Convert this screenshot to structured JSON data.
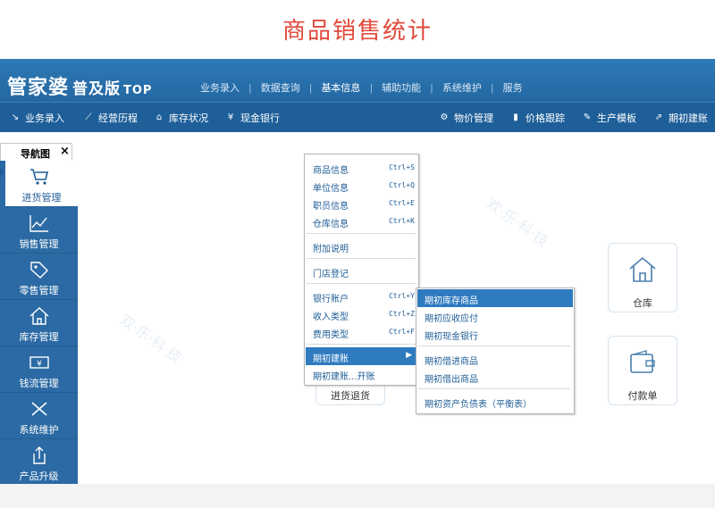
{
  "page_title": "商品销售统计",
  "app": {
    "logo": {
      "main": "管家婆",
      "edition": "普及版",
      "tag": "TOP"
    },
    "top_menu": [
      {
        "label": "业务录入"
      },
      {
        "label": "数据查询"
      },
      {
        "label": "基本信息",
        "active": true
      },
      {
        "label": "辅助功能"
      },
      {
        "label": "系统维护"
      },
      {
        "label": "服务"
      }
    ],
    "toolbar": [
      {
        "label": "业务录入",
        "icon": "arrow-icon"
      },
      {
        "label": "经营历程",
        "icon": "chart-icon"
      },
      {
        "label": "库存状况",
        "icon": "home-icon"
      },
      {
        "label": "现金银行",
        "icon": "yen-icon"
      },
      {
        "label": "物价管理",
        "icon": "gear-icon"
      },
      {
        "label": "价格跟踪",
        "icon": "bar-icon"
      },
      {
        "label": "生产模板",
        "icon": "wrench-icon"
      },
      {
        "label": "期初建账",
        "icon": "share-icon"
      }
    ],
    "nav_tab": {
      "label": "导航图",
      "close": "×"
    },
    "sidebar": [
      {
        "label": "进货管理",
        "icon": "cart-icon",
        "active": true
      },
      {
        "label": "销售管理",
        "icon": "line-chart-icon"
      },
      {
        "label": "零售管理",
        "icon": "tag-icon"
      },
      {
        "label": "库存管理",
        "icon": "house-icon"
      },
      {
        "label": "钱流管理",
        "icon": "money-icon"
      },
      {
        "label": "系统维护",
        "icon": "tools-icon"
      },
      {
        "label": "产品升级",
        "icon": "upload-icon"
      }
    ],
    "cards": [
      {
        "label": "仓库",
        "icon": "house-icon"
      },
      {
        "label": "进货退货",
        "icon": "return-doc-icon"
      },
      {
        "label": "付款单",
        "icon": "wallet-icon"
      }
    ],
    "dropdown": [
      {
        "label": "商品信息",
        "shortcut": "Ctrl+S"
      },
      {
        "label": "单位信息",
        "shortcut": "Ctrl+Q"
      },
      {
        "label": "职员信息",
        "shortcut": "Ctrl+E"
      },
      {
        "label": "仓库信息",
        "shortcut": "Ctrl+K"
      },
      {
        "label": "附加说明",
        "shortcut": ""
      },
      {
        "label": "门店登记",
        "shortcut": ""
      },
      {
        "label": "银行账户",
        "shortcut": "Ctrl+Y"
      },
      {
        "label": "收入类型",
        "shortcut": "Ctrl+Z"
      },
      {
        "label": "费用类型",
        "shortcut": "Ctrl+F"
      },
      {
        "label": "期初建账",
        "shortcut": "",
        "selected": true,
        "arrow": "▶"
      },
      {
        "label": "期初建账...开账",
        "shortcut": ""
      }
    ],
    "submenu": [
      {
        "label": "期初库存商品",
        "selected": true
      },
      {
        "label": "期初应收应付"
      },
      {
        "label": "期初现金银行"
      },
      {
        "label": "期初借进商品"
      },
      {
        "label": "期初借出商品"
      },
      {
        "label": "期初资产负债表（平衡表）"
      }
    ]
  }
}
